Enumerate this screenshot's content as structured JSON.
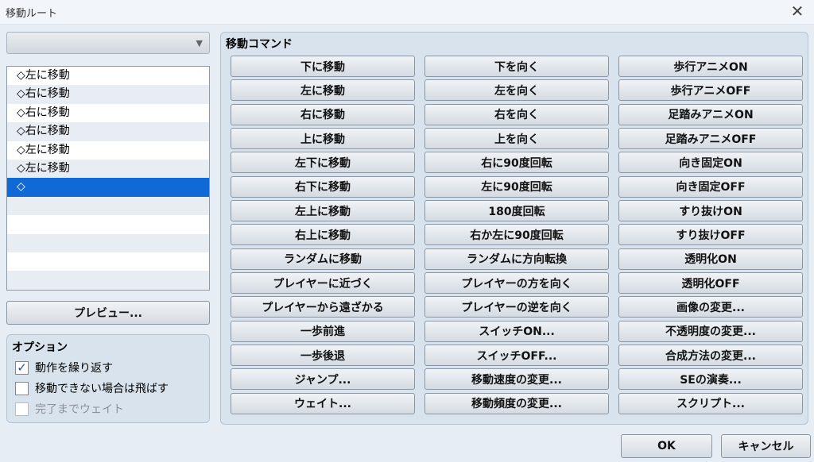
{
  "window": {
    "title": "移動ルート",
    "close_glyph": "✕"
  },
  "route_selector": {
    "value": "",
    "arrow": "▼"
  },
  "route_list": [
    "◇左に移動",
    "◇右に移動",
    "◇右に移動",
    "◇右に移動",
    "◇左に移動",
    "◇左に移動",
    "◇",
    "",
    "",
    "",
    "",
    ""
  ],
  "route_selected_index": 6,
  "preview_label": "プレビュー...",
  "options": {
    "title": "オプション",
    "repeat": {
      "label": "動作を繰り返す",
      "checked": true
    },
    "skip": {
      "label": "移動できない場合は飛ばす",
      "checked": false
    },
    "wait": {
      "label": "完了までウェイト",
      "checked": false,
      "disabled": true
    }
  },
  "commands": {
    "title": "移動コマンド",
    "col1": [
      "下に移動",
      "左に移動",
      "右に移動",
      "上に移動",
      "左下に移動",
      "右下に移動",
      "左上に移動",
      "右上に移動",
      "ランダムに移動",
      "プレイヤーに近づく",
      "プレイヤーから遠ざかる",
      "一歩前進",
      "一歩後退",
      "ジャンプ...",
      "ウェイト..."
    ],
    "col2": [
      "下を向く",
      "左を向く",
      "右を向く",
      "上を向く",
      "右に90度回転",
      "左に90度回転",
      "180度回転",
      "右か左に90度回転",
      "ランダムに方向転換",
      "プレイヤーの方を向く",
      "プレイヤーの逆を向く",
      "スイッチON...",
      "スイッチOFF...",
      "移動速度の変更...",
      "移動頻度の変更..."
    ],
    "col3": [
      "歩行アニメON",
      "歩行アニメOFF",
      "足踏みアニメON",
      "足踏みアニメOFF",
      "向き固定ON",
      "向き固定OFF",
      "すり抜けON",
      "すり抜けOFF",
      "透明化ON",
      "透明化OFF",
      "画像の変更...",
      "不透明度の変更...",
      "合成方法の変更...",
      "SEの演奏...",
      "スクリプト..."
    ]
  },
  "footer": {
    "ok": "OK",
    "cancel": "キャンセル"
  }
}
